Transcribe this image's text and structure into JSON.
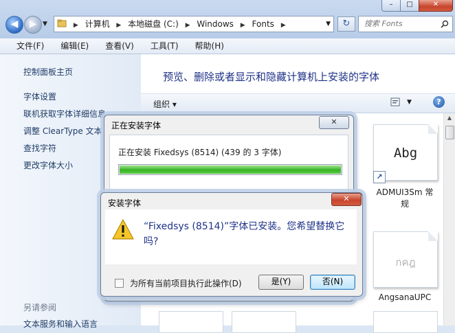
{
  "window": {
    "min_label": "–",
    "max_label": "□",
    "close_label": "✕"
  },
  "nav": {
    "back_glyph": "◀",
    "forward_glyph": "▶",
    "refresh_glyph": "↻"
  },
  "address": {
    "crumbs": [
      "计算机",
      "本地磁盘 (C:)",
      "Windows",
      "Fonts"
    ]
  },
  "search": {
    "placeholder": "搜索 Fonts"
  },
  "menu": [
    "文件(F)",
    "编辑(E)",
    "查看(V)",
    "工具(T)",
    "帮助(H)"
  ],
  "sidebar": {
    "items": [
      "控制面板主页",
      "字体设置",
      "联机获取字体详细信息",
      "调整 ClearType 文本",
      "查找字符",
      "更改字体大小"
    ],
    "see_also": "另请参阅",
    "see_also_items": [
      "文本服务和输入语言"
    ]
  },
  "content": {
    "heading": "预览、删除或者显示和隐藏计算机上安装的字体",
    "organize_label": "组织 ▾",
    "fonts": [
      {
        "sample": "Abg",
        "name": "ADMUI3Sm 常规"
      },
      {
        "sample": "กคฎ",
        "name": "AngsanaUPC"
      }
    ]
  },
  "progress_dialog": {
    "title": "正在安装字体",
    "status": "正在安装 Fixedsys (8514) (439 的 3 字体)",
    "progress_fraction": 1.0
  },
  "confirm_dialog": {
    "title": "安装字体",
    "message": "“Fixedsys (8514)”字体已安装。您希望替换它吗?",
    "checkbox_label": "为所有当前项目执行此操作(D)",
    "yes_label": "是(Y)",
    "no_label": "否(N)"
  },
  "colors": {
    "progress_green": "#37b324",
    "link_blue": "#1f3c67",
    "heading_blue": "#1e3287"
  }
}
